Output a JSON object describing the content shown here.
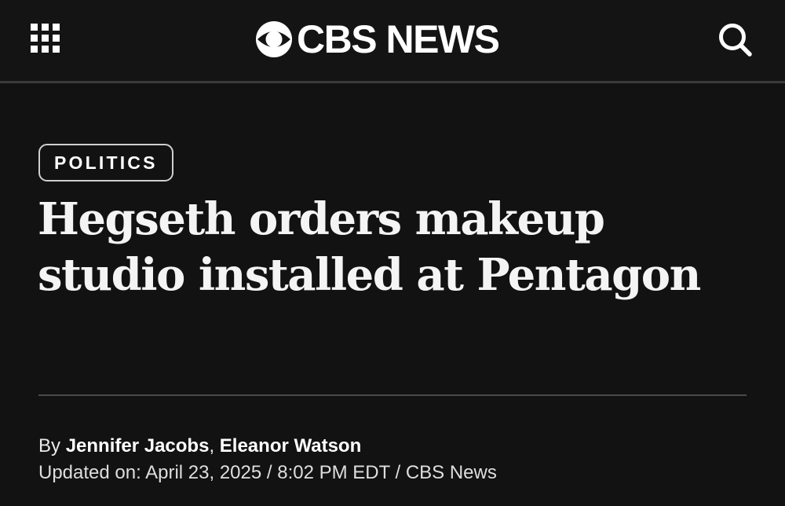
{
  "header": {
    "brand": "CBS NEWS",
    "menu_icon": "grid-menu-icon",
    "search_icon": "search-icon",
    "logo_icon": "cbs-eye-icon"
  },
  "article": {
    "category": "POLITICS",
    "headline": "Hegseth orders makeup studio installed at Pentagon",
    "byline_prefix": "By",
    "authors": [
      "Jennifer Jacobs",
      "Eleanor Watson"
    ],
    "author_separator": ",",
    "dateline": "Updated on: April 23, 2025 / 8:02 PM EDT / CBS News"
  },
  "colors": {
    "background": "#121212",
    "text": "#f2f2f2",
    "divider": "#4a4a4a"
  }
}
